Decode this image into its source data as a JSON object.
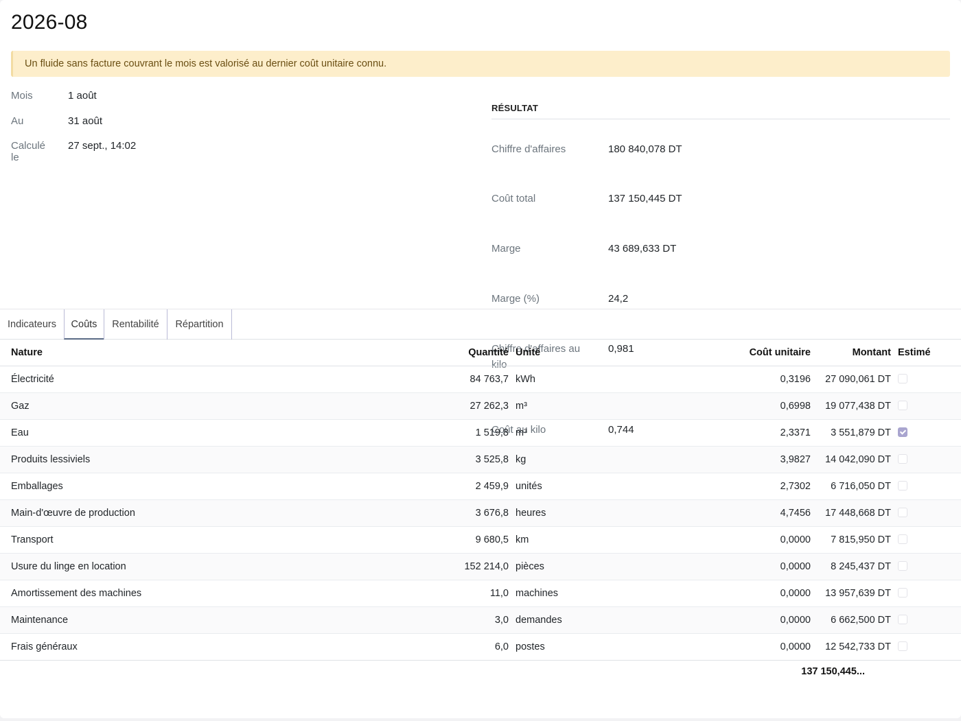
{
  "page": {
    "title": "2026-08",
    "alert": "Un fluide sans facture couvrant le mois est valorisé au dernier coût unitaire connu."
  },
  "info": [
    {
      "label": "Mois",
      "value": "1 août"
    },
    {
      "label": "Au",
      "value": "31 août"
    },
    {
      "label": "Calculé le",
      "value": "27 sept., 14:02"
    }
  ],
  "result": {
    "heading": "RÉSULTAT",
    "rows": [
      {
        "label": "Chiffre d'affaires",
        "value": "180 840,078 DT"
      },
      {
        "label": "Coût total",
        "value": "137 150,445 DT"
      },
      {
        "label": "Marge",
        "value": "43 689,633 DT"
      },
      {
        "label": "Marge (%)",
        "value": "24,2"
      },
      {
        "label": "Chiffre d'affaires au kilo",
        "value": "0,981"
      },
      {
        "label": "Coût au kilo",
        "value": "0,744"
      }
    ]
  },
  "tabs": [
    "Indicateurs",
    "Coûts",
    "Rentabilité",
    "Répartition"
  ],
  "table": {
    "headers": {
      "nature": "Nature",
      "quantity": "Quantité",
      "unit": "Unité",
      "unit_cost": "Coût unitaire",
      "amount": "Montant",
      "estimated": "Estimé"
    },
    "rows": [
      {
        "nature": "Électricité",
        "quantity": "84 763,7",
        "unit": "kWh",
        "unit_cost": "0,3196",
        "amount": "27 090,061 DT",
        "estimated": false
      },
      {
        "nature": "Gaz",
        "quantity": "27 262,3",
        "unit": "m³",
        "unit_cost": "0,6998",
        "amount": "19 077,438 DT",
        "estimated": false
      },
      {
        "nature": "Eau",
        "quantity": "1 519,8",
        "unit": "m³",
        "unit_cost": "2,3371",
        "amount": "3 551,879 DT",
        "estimated": true
      },
      {
        "nature": "Produits lessiviels",
        "quantity": "3 525,8",
        "unit": "kg",
        "unit_cost": "3,9827",
        "amount": "14 042,090 DT",
        "estimated": false
      },
      {
        "nature": "Emballages",
        "quantity": "2 459,9",
        "unit": "unités",
        "unit_cost": "2,7302",
        "amount": "6 716,050 DT",
        "estimated": false
      },
      {
        "nature": "Main-d'œuvre de production",
        "quantity": "3 676,8",
        "unit": "heures",
        "unit_cost": "4,7456",
        "amount": "17 448,668 DT",
        "estimated": false
      },
      {
        "nature": "Transport",
        "quantity": "9 680,5",
        "unit": "km",
        "unit_cost": "0,0000",
        "amount": "7 815,950 DT",
        "estimated": false
      },
      {
        "nature": "Usure du linge en location",
        "quantity": "152 214,0",
        "unit": "pièces",
        "unit_cost": "0,0000",
        "amount": "8 245,437 DT",
        "estimated": false
      },
      {
        "nature": "Amortissement des machines",
        "quantity": "11,0",
        "unit": "machines",
        "unit_cost": "0,0000",
        "amount": "13 957,639 DT",
        "estimated": false
      },
      {
        "nature": "Maintenance",
        "quantity": "3,0",
        "unit": "demandes",
        "unit_cost": "0,0000",
        "amount": "6 662,500 DT",
        "estimated": false
      },
      {
        "nature": "Frais généraux",
        "quantity": "6,0",
        "unit": "postes",
        "unit_cost": "0,0000",
        "amount": "12 542,733 DT",
        "estimated": false
      }
    ],
    "total": "137 150,445..."
  }
}
